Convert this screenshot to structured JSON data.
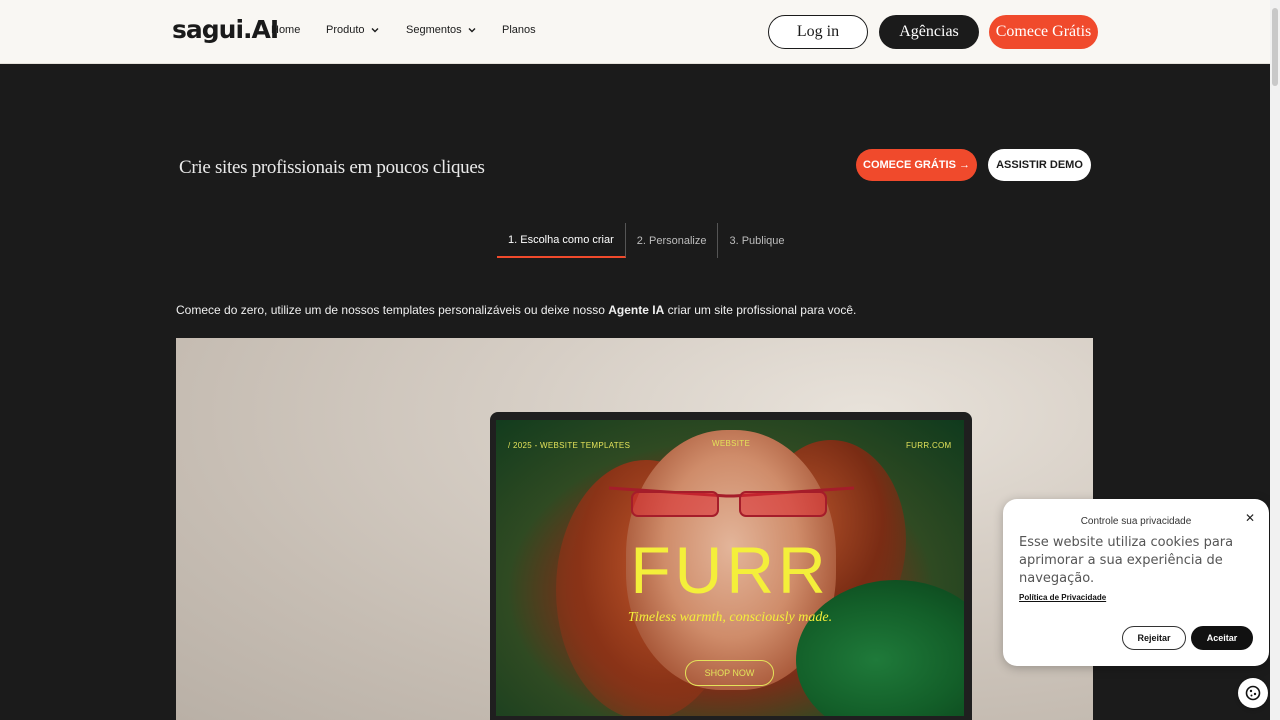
{
  "header": {
    "logo": "sagui.AI",
    "nav": [
      {
        "label": "Home"
      },
      {
        "label": "Produto"
      },
      {
        "label": "Segmentos"
      },
      {
        "label": "Planos"
      }
    ],
    "login_label": "Log in",
    "agencias_label": "Agências",
    "comece_label": "Comece Grátis"
  },
  "hero": {
    "title": "Crie sites profissionais em poucos cliques",
    "cta_start": "COMECE GRÁTIS →",
    "cta_demo": "ASSISTIR DEMO"
  },
  "tabs": [
    {
      "label": "1. Escolha como criar",
      "active": true
    },
    {
      "label": "2. Personalize",
      "active": false
    },
    {
      "label": "3. Publique",
      "active": false
    }
  ],
  "description": {
    "before": "Comece do zero, utilize um de nossos templates personalizáveis ou deixe nosso ",
    "bold": "Agente IA",
    "after": " criar um site profissional para você."
  },
  "preview": {
    "top_left": "/ 2025 -  WEBSITE TEMPLATES",
    "top_center": "WEBSITE",
    "top_right": "FURR.COM",
    "brand": "FURR",
    "tagline": "Timeless warmth, consciously made.",
    "shop": "SHOP NOW"
  },
  "cookie": {
    "title": "Controle sua privacidade",
    "body": "Esse website utiliza cookies para aprimorar a sua experiência de navegação.",
    "policy_link": "Política de Privacidade",
    "reject": "Rejeitar",
    "accept": "Aceitar"
  },
  "colors": {
    "accent": "#f04a2c",
    "dark": "#1b1b1b",
    "header_bg": "#f9f7f3",
    "furr_yellow": "#f4ef3a"
  }
}
